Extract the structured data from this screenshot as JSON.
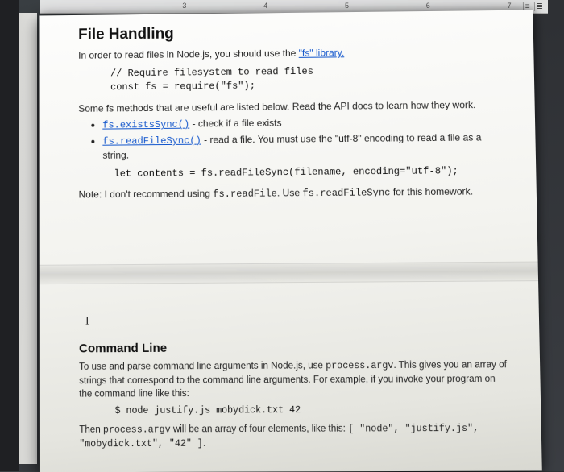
{
  "ruler": {
    "marks": [
      "3",
      "4",
      "5",
      "6",
      "7"
    ]
  },
  "toolbar": {
    "b1": "≡",
    "b2": "≣"
  },
  "sec1": {
    "heading": "File Handling",
    "intro_pre": "In order to read files in Node.js, you should use the ",
    "intro_link": "\"fs\" library.",
    "code1": "// Require filesystem to read files\nconst fs = require(\"fs\");",
    "methods_intro": "Some fs methods that are useful are listed below. Read the API docs to learn how they work.",
    "li1_link": "fs.existsSync()",
    "li1_rest": "  -  check if a file exists",
    "li2_link": "fs.readFileSync()",
    "li2_rest": "  -  read a file. You must use the \"utf-8\" encoding to read a file as a string.",
    "code2": "let contents = fs.readFileSync(filename, encoding=\"utf-8\");",
    "note_pre": "Note: I don't recommend using ",
    "note_m1": "fs.readFile",
    "note_mid": ". Use ",
    "note_m2": "fs.readFileSync",
    "note_post": " for this homework."
  },
  "cursor": "I",
  "sec2": {
    "heading": "Command Line",
    "p1_pre": "To use and parse command line arguments in Node.js, use ",
    "p1_m": "process.argv",
    "p1_post": ". This gives you an array of strings that correspond to the command line arguments. For example, if you invoke your program on the command line like this:",
    "code": "$ node justify.js mobydick.txt 42",
    "p2_pre": "Then ",
    "p2_m": "process.argv",
    "p2_mid": " will be an array of four elements, like this: ",
    "p2_arr": "[ \"node\", \"justify.js\", \"mobydick.txt\", \"42\" ]",
    "p2_post": "."
  }
}
